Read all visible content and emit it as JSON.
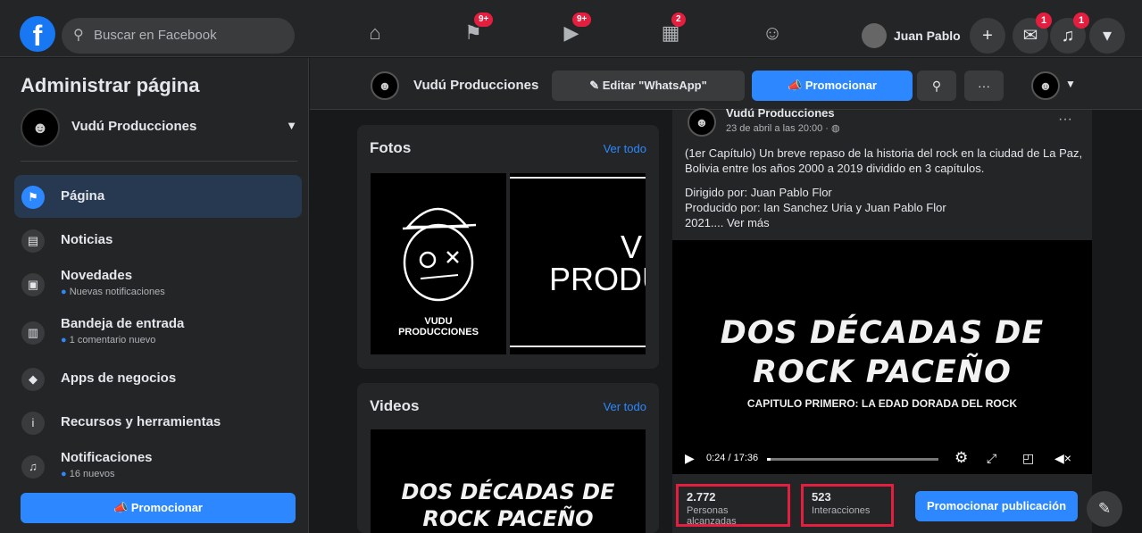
{
  "topbar": {
    "logo": "f",
    "search_placeholder": "Buscar en Facebook",
    "nav": [
      {
        "icon": "home-icon",
        "glyph": "⌂",
        "badge": ""
      },
      {
        "icon": "flag-icon",
        "glyph": "⚑",
        "badge": "9+"
      },
      {
        "icon": "video-icon",
        "glyph": "▶",
        "badge": "9+"
      },
      {
        "icon": "marketplace-icon",
        "glyph": "▦",
        "badge": "2"
      },
      {
        "icon": "groups-icon",
        "glyph": "☺",
        "badge": ""
      }
    ],
    "profile_name": "Juan Pablo",
    "plus": "+",
    "messenger_badge": "1",
    "notifications_badge": "1"
  },
  "sidebar": {
    "title": "Administrar página",
    "page_name": "Vudú Producciones",
    "items": [
      {
        "label": "Página",
        "sub": ""
      },
      {
        "label": "Noticias",
        "sub": ""
      },
      {
        "label": "Novedades",
        "sub": "Nuevas notificaciones"
      },
      {
        "label": "Bandeja de entrada",
        "sub": "1 comentario nuevo"
      },
      {
        "label": "Apps de negocios",
        "sub": ""
      },
      {
        "label": "Recursos y herramientas",
        "sub": ""
      },
      {
        "label": "Notificaciones",
        "sub": "16 nuevos"
      }
    ],
    "promote": "Promocionar"
  },
  "pagebar": {
    "page_name": "Vudú Producciones",
    "edit_label": "Editar \"WhatsApp\"",
    "promote_label": "Promocionar",
    "more": "···"
  },
  "photos": {
    "title": "Fotos",
    "see_all": "Ver todo",
    "thumb1_text": "VUDU\nPRODUCCIONES",
    "thumb2_text": "PRODU",
    "thumb2_top": "V"
  },
  "videos": {
    "title": "Videos",
    "see_all": "Ver todo",
    "thumb_line1": "DOS DÉCADAS DE",
    "thumb_line2": "ROCK PACEÑO"
  },
  "post": {
    "author": "Vudú Producciones",
    "date": "23 de abril a las 20:00 · ",
    "more": "···",
    "text1": "(1er Capítulo) Un breve repaso de la historia del rock en la ciudad de La Paz, Bolivia entre los años 2000 a 2019 dividido en 3 capítulos.",
    "text2": "Dirigido por: Juan Pablo Flor",
    "text3": "Producido por: Ian Sanchez Uria y Juan Pablo Flor",
    "text4": "2021.... Ver más",
    "video_title1": "DOS DÉCADAS DE",
    "video_title2": "ROCK PACEÑO",
    "video_subtitle": "CAPITULO PRIMERO: LA EDAD DORADA DEL ROCK",
    "time": "0:24 / 17:36",
    "progress": 0.023,
    "reach_value": "2.772",
    "reach_label": "Personas alcanzadas",
    "interactions_value": "523",
    "interactions_label": "Interacciones",
    "promote_label": "Promocionar publicación"
  }
}
